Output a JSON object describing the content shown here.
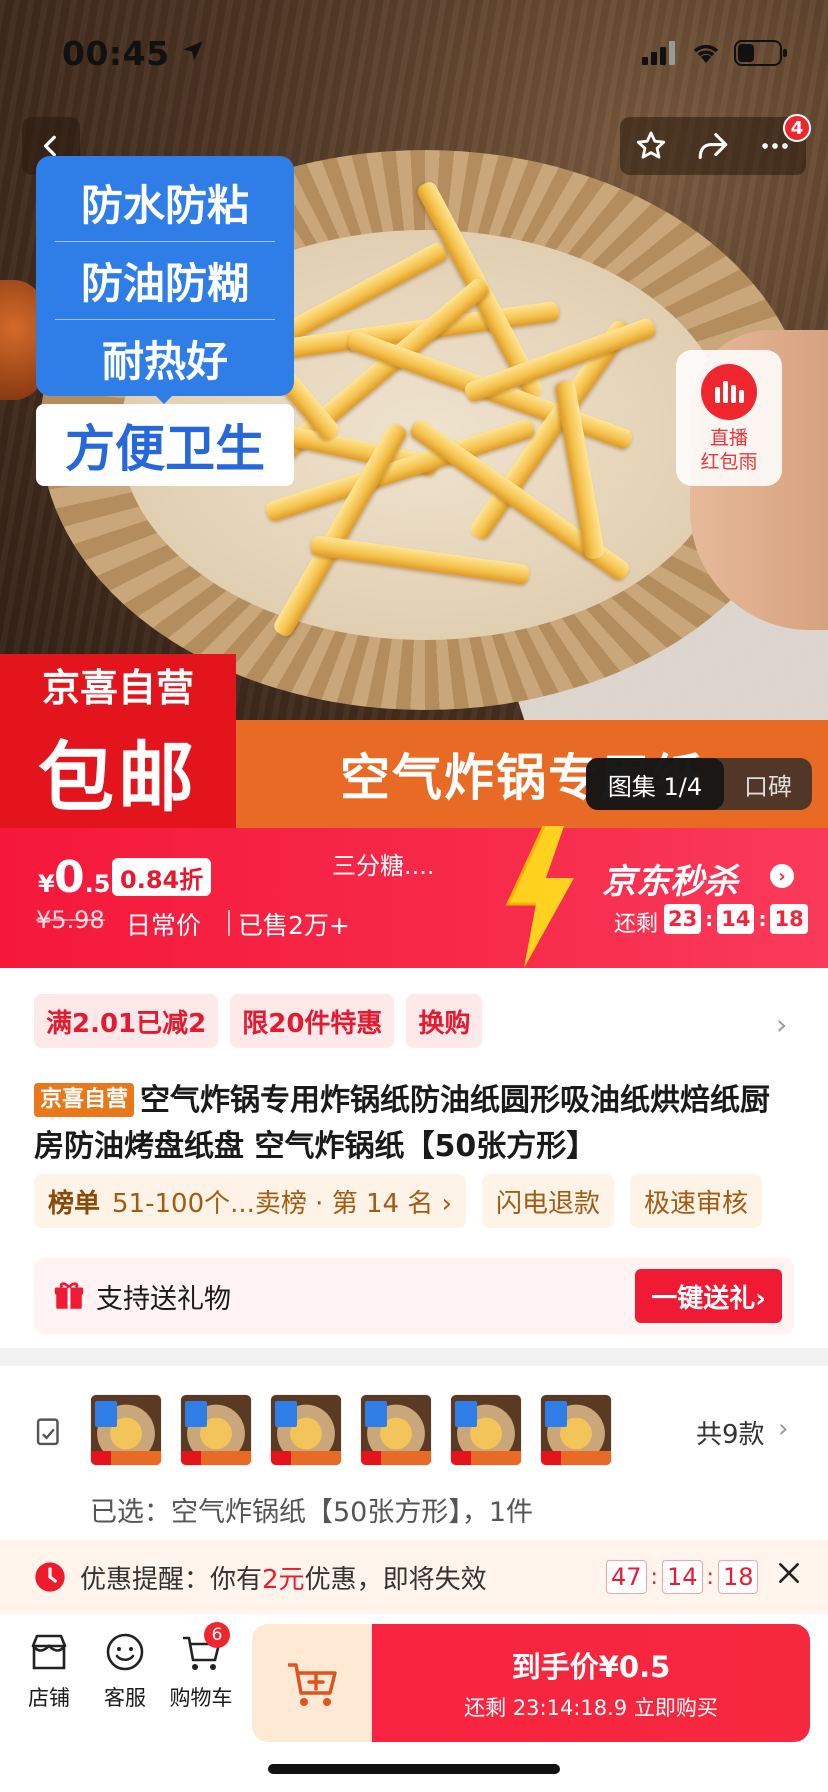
{
  "status_bar": {
    "time": "00:45"
  },
  "nav": {
    "badge_count": "4"
  },
  "hero": {
    "features": [
      "防水防粘",
      "防油防糊",
      "耐热好"
    ],
    "feature_highlight": "方便卫生",
    "live_redpack_line1": "直播",
    "live_redpack_line2": "红包雨",
    "brand_line": "京喜自营",
    "free_shipping": "包邮",
    "product_banner": "空气炸锅专用纸",
    "gallery_label": "图集 1/4",
    "reviews_label": "口碑"
  },
  "price_bar": {
    "currency": "¥",
    "price_int": "0",
    "price_dec": ".5",
    "discount": "0.84折",
    "shop_name": "三分糖....",
    "original_price": "¥5.98",
    "daily_price_label": "日常价",
    "sold": "已售2万+",
    "seckill_title": "京东秒杀",
    "remain_label": "还剩",
    "timer": [
      "23",
      "14",
      "18"
    ]
  },
  "promos": [
    "满2.01已减2",
    "限20件特惠",
    "换购"
  ],
  "product": {
    "badge": "京喜自营",
    "title": "空气炸锅专用炸锅纸防油纸圆形吸油纸烘焙纸厨房防油烤盘纸盘 空气炸锅纸【50张方形】"
  },
  "rank": {
    "label": "榜单",
    "text": "51-100个...卖榜 · 第 14 名 ›"
  },
  "services": [
    "闪电退款",
    "极速审核"
  ],
  "gift": {
    "text": "支持送礼物",
    "button": "一键送礼›"
  },
  "variants": {
    "count_label": "共9款",
    "selected_text": "已选：空气炸锅纸【50张方形】，1件",
    "thumbs": [
      1,
      2,
      3,
      4,
      5,
      6
    ]
  },
  "coupon": {
    "prefix": "优惠提醒：你有",
    "amount": "2元",
    "suffix": "优惠，即将失效",
    "timer": [
      "47",
      "14",
      "18"
    ]
  },
  "bottom_bar": {
    "shop": "店铺",
    "service": "客服",
    "cart": "购物车",
    "cart_count": "6",
    "buy_line1": "到手价¥0.5",
    "buy_line2": "还剩 23:14:18.9 立即购买"
  },
  "colors": {
    "accent_red": "#f01a34",
    "brand_blue": "#2f7ee8",
    "orange": "#e86a24"
  }
}
